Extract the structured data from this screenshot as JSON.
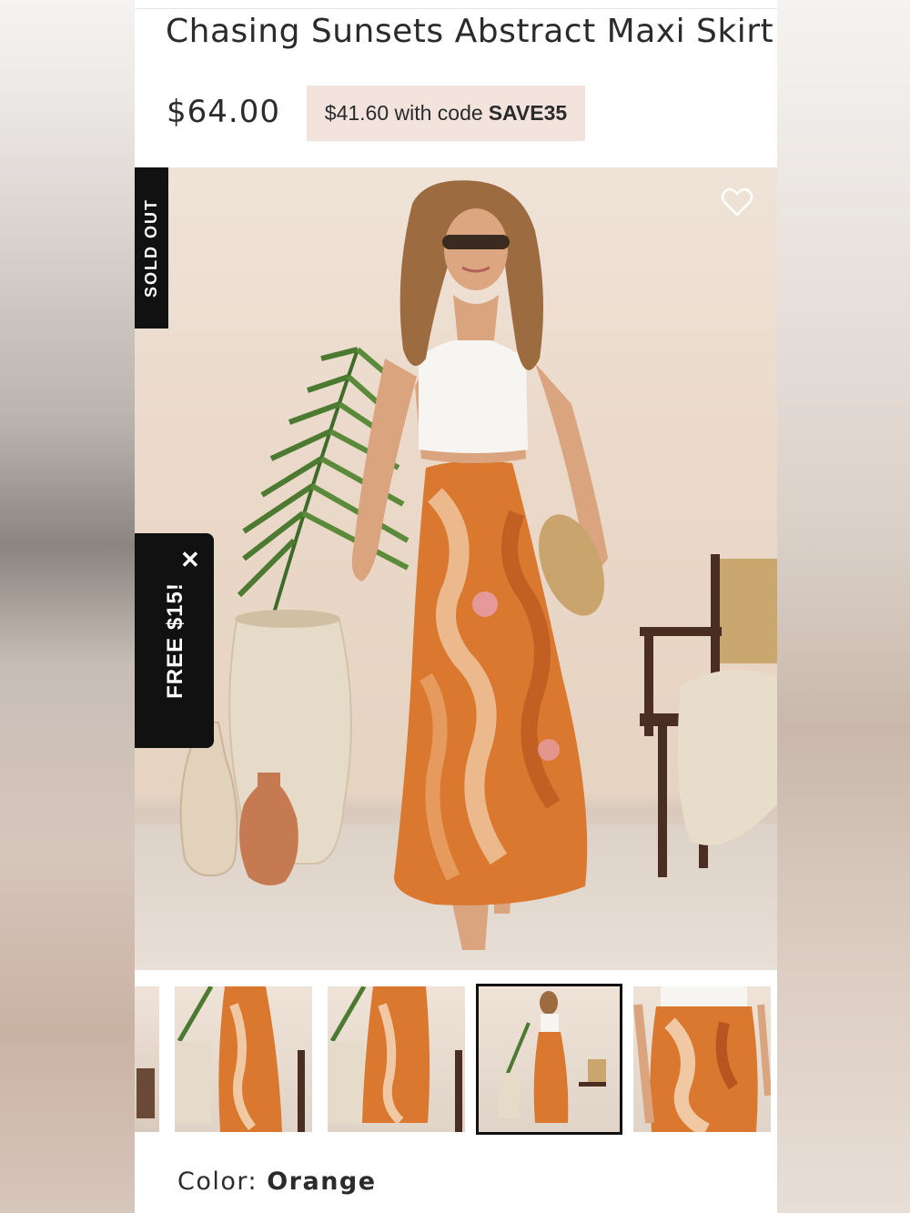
{
  "product": {
    "title": "Chasing Sunsets Abstract Maxi Skirt",
    "price": "$64.00",
    "promo_prefix": "$41.60 with code",
    "promo_code": "SAVE35"
  },
  "badges": {
    "sold_out": "SOLD OUT",
    "free_offer": "FREE $15!",
    "close_symbol": "✕"
  },
  "icons": {
    "wishlist": "heart-outline-icon"
  },
  "gallery": {
    "thumbnail_count": 5,
    "selected_index": 3
  },
  "color": {
    "label": "Color:",
    "value": "Orange"
  },
  "colors": {
    "promo_bg": "#f2e4dc",
    "badge_bg": "#111111",
    "skirt_orange": "#d9782e"
  }
}
